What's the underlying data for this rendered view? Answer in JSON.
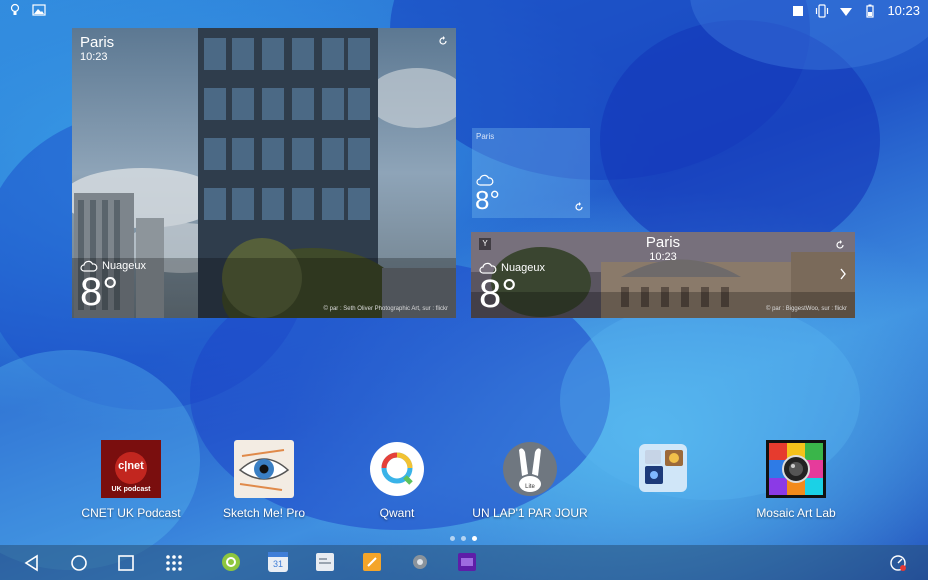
{
  "status_bar": {
    "time": "10:23",
    "left_icons": [
      "lightbulb-icon",
      "image-icon"
    ],
    "right_icons": [
      "cast-icon",
      "vibrate-icon",
      "wifi-icon",
      "battery-icon"
    ]
  },
  "widgets": {
    "large": {
      "city": "Paris",
      "time": "10:23",
      "condition": "Nuageux",
      "temp": "8°",
      "credit": "© par : Seth Oliver Photographic Art, sur : flickr"
    },
    "small": {
      "city": "Paris",
      "temp": "8°"
    },
    "wide": {
      "city": "Paris",
      "time": "10:23",
      "condition": "Nuageux",
      "temp": "8°",
      "credit": "© par : BiggestWoo, sur : flickr"
    }
  },
  "apps": [
    {
      "label": "CNET UK Podcast",
      "icon": "cnet-icon",
      "icon_text": "c|net",
      "icon_sub": "UK podcast"
    },
    {
      "label": "Sketch Me! Pro",
      "icon": "eye-sketch-icon"
    },
    {
      "label": "Qwant",
      "icon": "qwant-icon"
    },
    {
      "label": "UN LAP'1 PAR JOUR",
      "icon": "rabbit-icon",
      "icon_sub": "Lite"
    },
    {
      "label": "",
      "icon": "folder-icon"
    },
    {
      "label": "Mosaic Art Lab",
      "icon": "mosaic-camera-icon"
    }
  ],
  "page_indicator": {
    "count": 3,
    "active": 3
  },
  "nav_bar": {
    "buttons": [
      "back-icon",
      "home-icon",
      "recents-icon",
      "app-drawer-icon"
    ],
    "dock": [
      "dock-green-app-icon",
      "calendar-icon",
      "docs-icon",
      "notes-icon",
      "settings-icon",
      "yahoo-icon"
    ],
    "calendar_day": "31",
    "right_icon": "data-saver-icon"
  },
  "colors": {
    "wallpaper": "#1f63c9",
    "nav_bar": "#2b5678",
    "qwant_accent": "#3ab3e8"
  }
}
